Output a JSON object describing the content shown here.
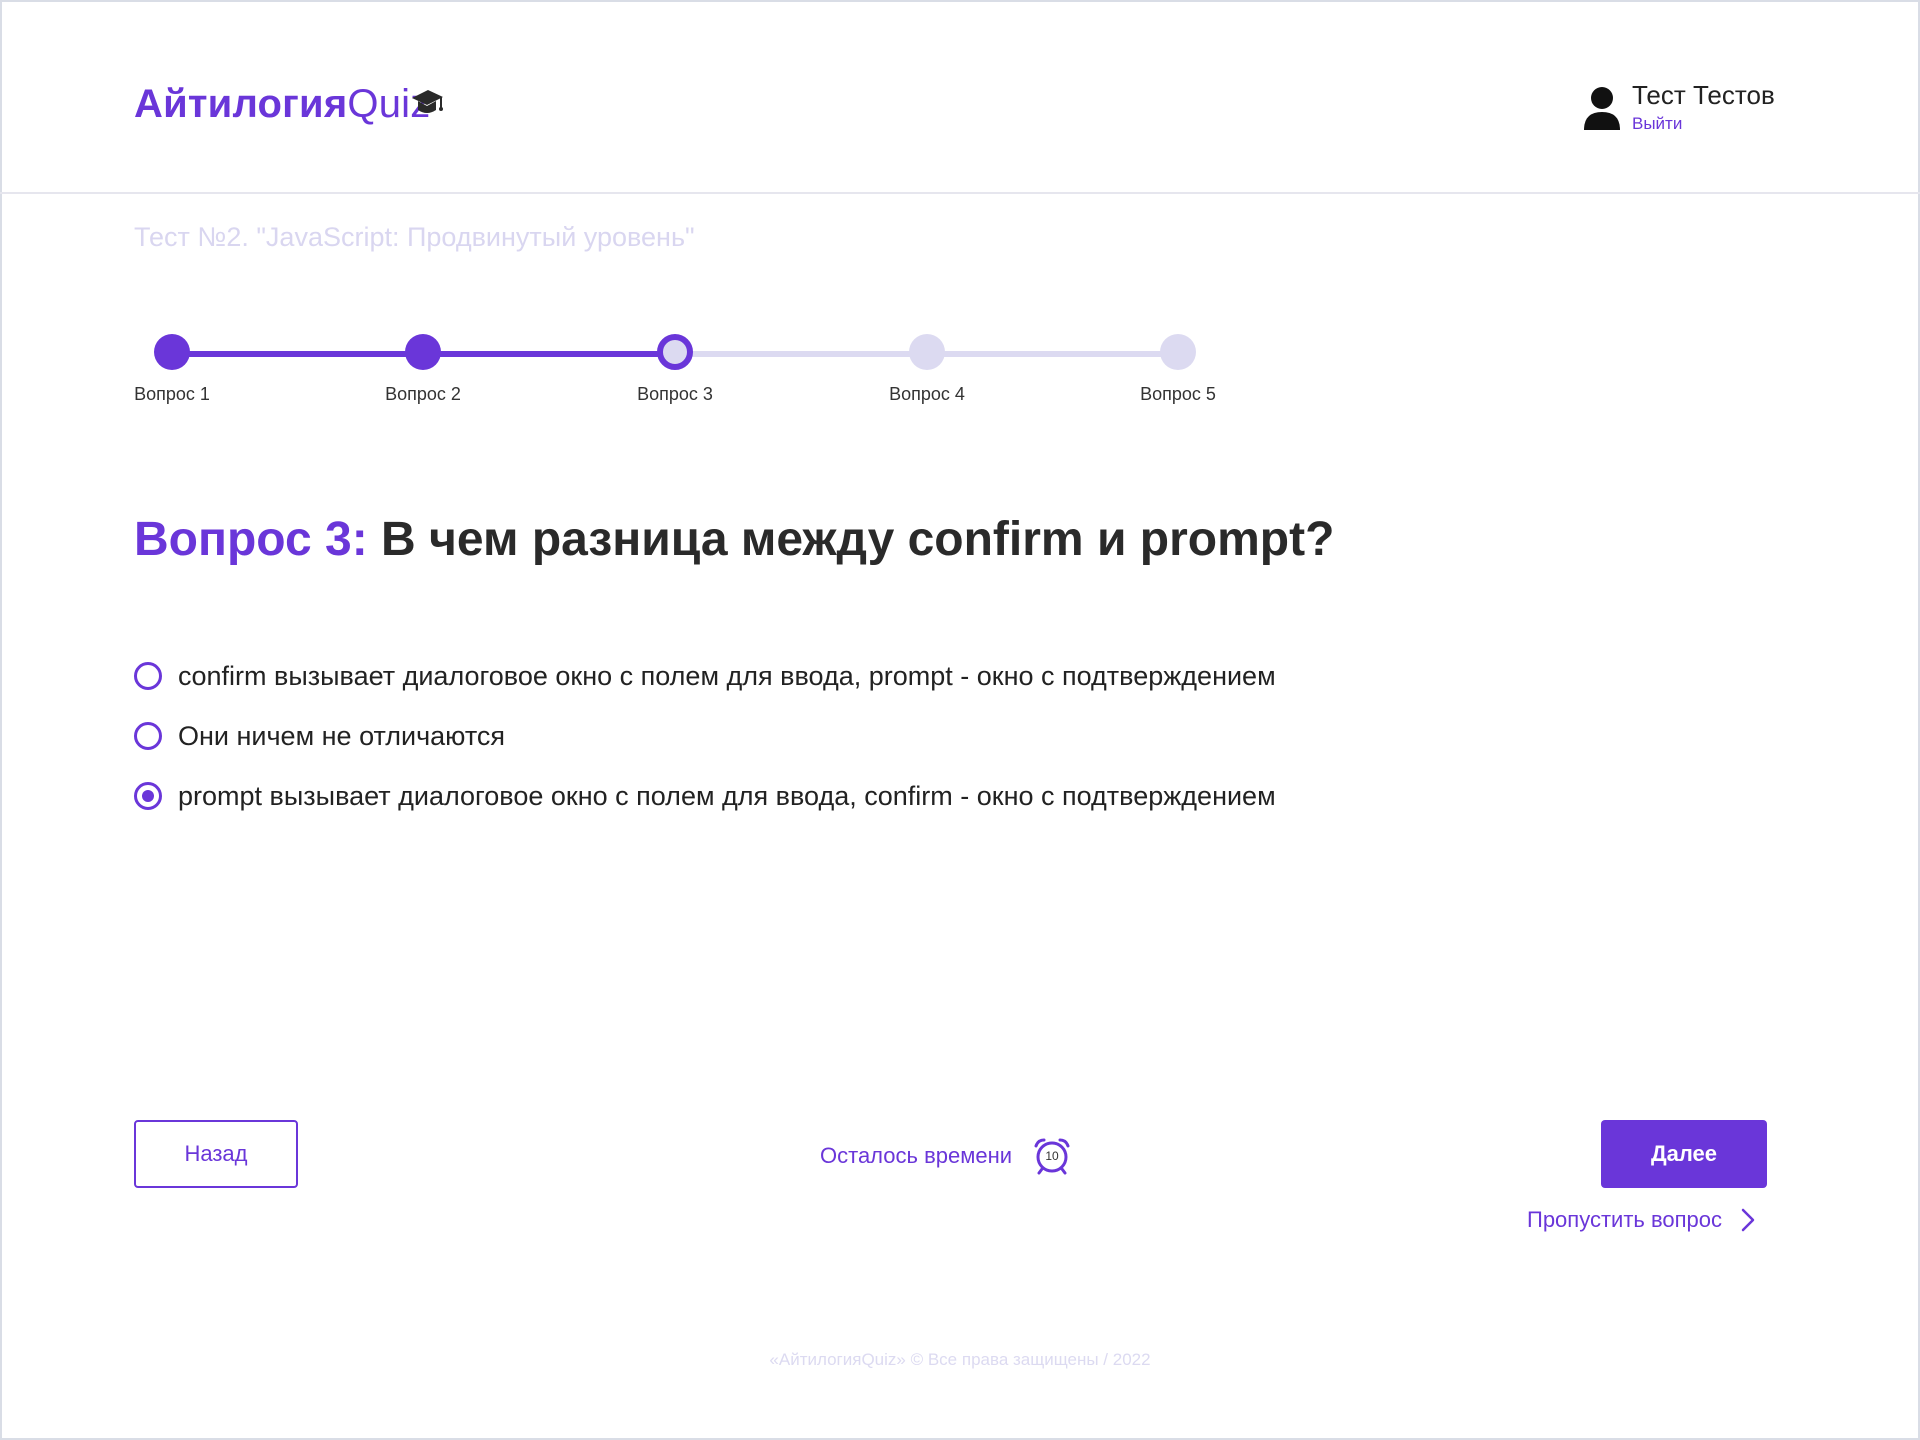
{
  "header": {
    "logo_main": "Айтилогия",
    "logo_suffix": "Quiz",
    "user_name": "Тест Тестов",
    "logout_label": "Выйти"
  },
  "test": {
    "title": "Тест №2. \"JavaScript: Продвинутый уровень\""
  },
  "stepper": {
    "steps": [
      {
        "label": "Вопрос 1",
        "state": "done"
      },
      {
        "label": "Вопрос 2",
        "state": "done"
      },
      {
        "label": "Вопрос 3",
        "state": "current"
      },
      {
        "label": "Вопрос 4",
        "state": "todo"
      },
      {
        "label": "Вопрос 5",
        "state": "todo"
      }
    ]
  },
  "question": {
    "number_label": "Вопрос 3:",
    "text": "В чем разница между confirm и prompt?",
    "options": [
      {
        "text": "confirm вызывает диалоговое окно с полем для ввода, prompt - окно с подтверждением",
        "selected": false
      },
      {
        "text": "Они ничем не отличаются",
        "selected": false
      },
      {
        "text": "prompt вызывает диалоговое окно с полем для ввода, confirm - окно с подтверждением",
        "selected": true
      }
    ]
  },
  "controls": {
    "back_label": "Назад",
    "timer_label": "Осталось времени",
    "timer_value": "10",
    "next_label": "Далее",
    "skip_label": "Пропустить вопрос"
  },
  "footer": {
    "text": "«АйтилогияQuiz» © Все права защищены / 2022"
  },
  "colors": {
    "accent": "#6a36d9",
    "inactive": "#dcdaf1"
  },
  "icons": {
    "logo": "graduation-cap-icon",
    "user": "user-avatar-icon",
    "timer": "alarm-clock-icon",
    "skip": "chevron-right-icon"
  }
}
